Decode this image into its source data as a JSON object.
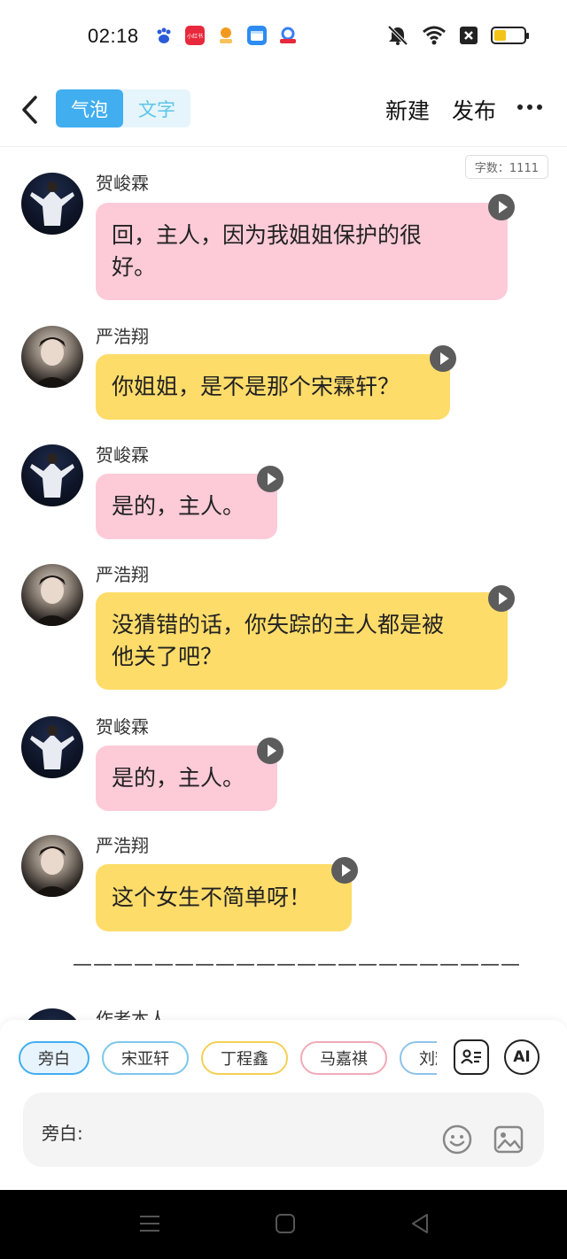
{
  "status_bar": {
    "time": "02:18",
    "notifications": [
      {
        "icon": "baidu-icon",
        "color": "#2a5bd7"
      },
      {
        "icon": "xiaohongshu-icon",
        "color": "#e8283c",
        "text": "小红书"
      },
      {
        "icon": "app-icon",
        "color": "#f39a1e"
      },
      {
        "icon": "files-icon",
        "color": "#2d8cf0"
      },
      {
        "icon": "app-icon-2",
        "color": "#3a7ff5"
      }
    ],
    "battery_level": 0.4
  },
  "header": {
    "tabs": [
      {
        "label": "气泡",
        "active": true
      },
      {
        "label": "文字",
        "active": false
      }
    ],
    "new_label": "新建",
    "publish_label": "发布"
  },
  "chat": {
    "word_count": "字数：1111",
    "messages": [
      {
        "speaker": "贺峻霖",
        "text": "回，主人，因为我姐姐保护的很好。",
        "line1": "回，主人，因为我姐姐保护的很",
        "line2": "好。",
        "color": "pink"
      },
      {
        "speaker": "严浩翔",
        "text": "你姐姐，是不是那个宋霖轩？",
        "color": "yellow"
      },
      {
        "speaker": "贺峻霖",
        "text": "是的，主人。",
        "color": "pink"
      },
      {
        "speaker": "严浩翔",
        "text": "没猜错的话，你失踪的主人都是被他关了吧？",
        "line1": "没猜错的话，你失踪的主人都是被",
        "line2": "他关了吧？",
        "color": "yellow"
      },
      {
        "speaker": "贺峻霖",
        "text": "是的，主人。",
        "color": "pink"
      },
      {
        "speaker": "严浩翔",
        "text": "这个女生不简单呀！",
        "color": "yellow"
      }
    ],
    "divider": "——————————————————————",
    "partial_speaker": "作者本人"
  },
  "composer": {
    "characters": [
      "旁白",
      "宋亚轩",
      "丁程鑫",
      "马嘉祺",
      "刘耀"
    ],
    "ai_label": "AI",
    "input_label": "旁白:"
  },
  "colors": {
    "accent": "#41aef0",
    "pink_bubble": "#fdcbd8",
    "yellow_bubble": "#fedc6a"
  }
}
